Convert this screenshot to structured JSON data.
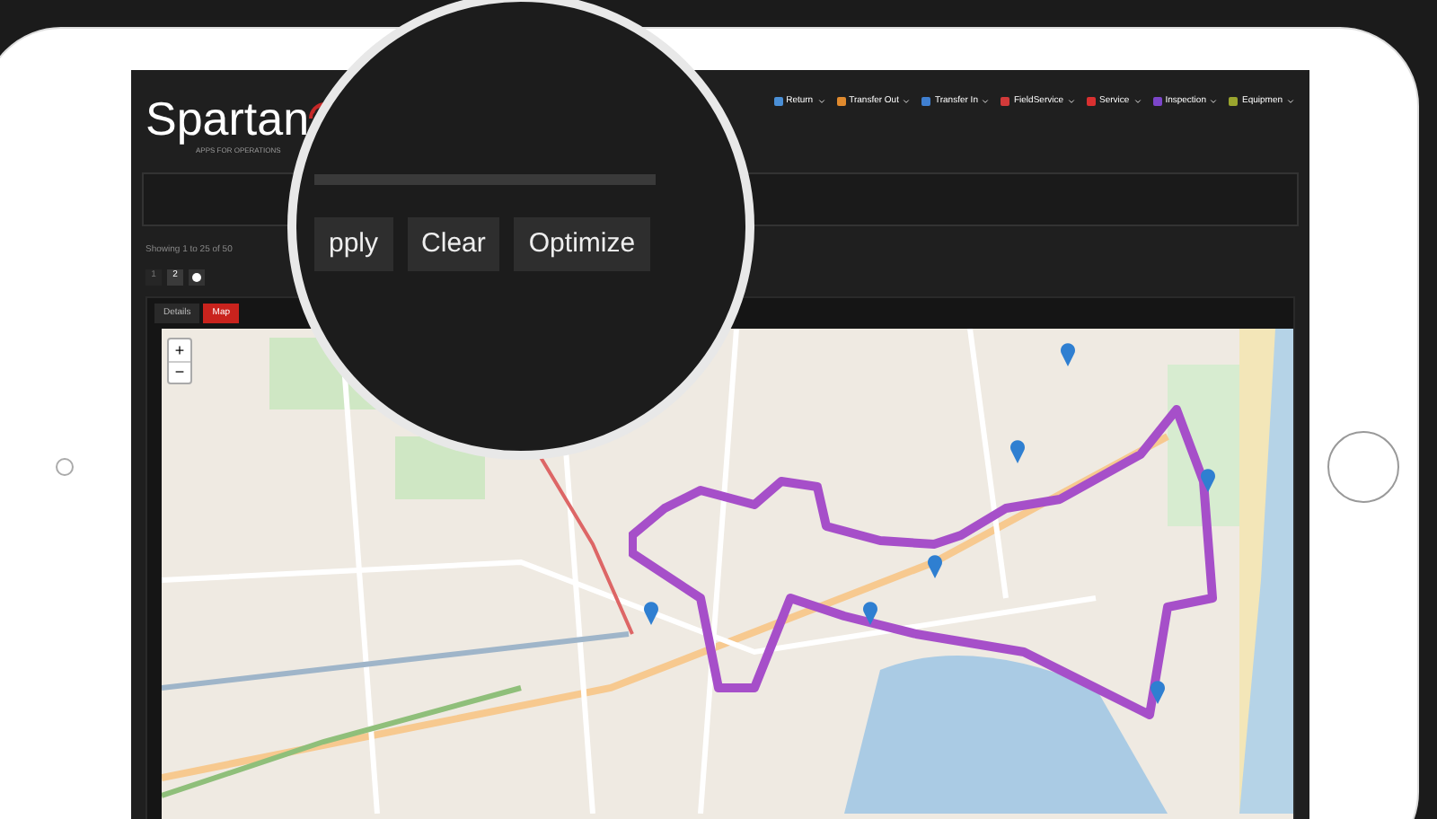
{
  "brand": {
    "name": "Spartan",
    "tagline": "APPS FOR OPERATIONS"
  },
  "nav": [
    {
      "label": "Return",
      "color": "#4a8fd6"
    },
    {
      "label": "Transfer Out",
      "color": "#e08a2e"
    },
    {
      "label": "Transfer In",
      "color": "#3f7fd0"
    },
    {
      "label": "FieldService",
      "color": "#d23a3a"
    },
    {
      "label": "Service",
      "color": "#d93030"
    },
    {
      "label": "Inspection",
      "color": "#7b45c9"
    },
    {
      "label": "Equipmen",
      "color": "#9aa52e"
    }
  ],
  "buttons": [
    "pply",
    "Clear",
    "Optimize"
  ],
  "results": {
    "summary": "Showing 1 to 25 of 50",
    "pages": [
      {
        "label": "1",
        "selected": false
      },
      {
        "label": "2",
        "selected": true
      }
    ]
  },
  "tabs": [
    {
      "label": "Details",
      "selected": false
    },
    {
      "label": "Map",
      "selected": true
    }
  ],
  "map": {
    "zoom_in": "+",
    "zoom_out": "−"
  }
}
